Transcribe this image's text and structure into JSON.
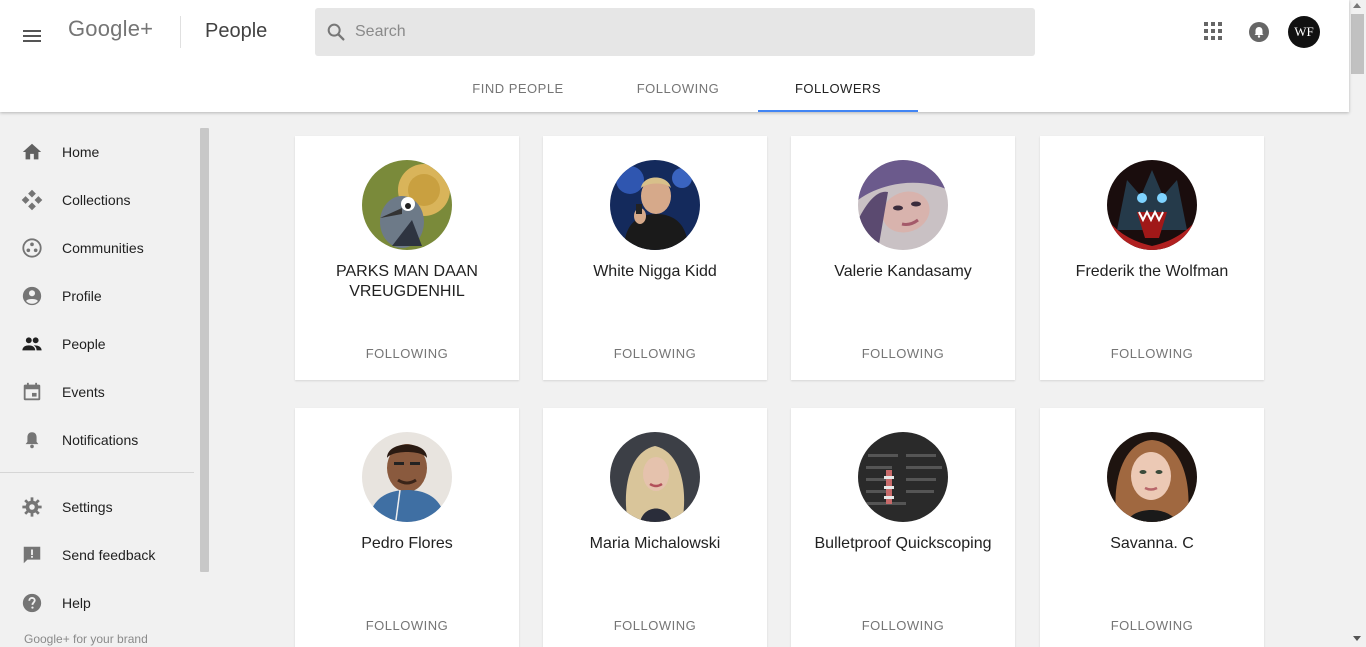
{
  "header": {
    "brand": "Google+",
    "title": "People",
    "search": {
      "placeholder": "Search",
      "value": ""
    },
    "account_initials": "WF"
  },
  "tabs": [
    {
      "label": "FIND PEOPLE",
      "active": false
    },
    {
      "label": "FOLLOWING",
      "active": false
    },
    {
      "label": "FOLLOWERS",
      "active": true
    }
  ],
  "sidebar": {
    "items": [
      {
        "label": "Home",
        "icon": "home-icon"
      },
      {
        "label": "Collections",
        "icon": "collections-icon"
      },
      {
        "label": "Communities",
        "icon": "communities-icon"
      },
      {
        "label": "Profile",
        "icon": "profile-icon"
      },
      {
        "label": "People",
        "icon": "people-icon"
      },
      {
        "label": "Events",
        "icon": "events-icon"
      },
      {
        "label": "Notifications",
        "icon": "bell-icon"
      }
    ],
    "secondary": [
      {
        "label": "Settings",
        "icon": "gear-icon"
      },
      {
        "label": "Send feedback",
        "icon": "feedback-icon"
      },
      {
        "label": "Help",
        "icon": "help-icon"
      }
    ],
    "footer_link": "Google+ for your brand"
  },
  "people": [
    {
      "name": "PARKS MAN DAAN VREUGDENHIL",
      "status": "FOLLOWING"
    },
    {
      "name": "White Nigga Kidd",
      "status": "FOLLOWING"
    },
    {
      "name": "Valerie Kandasamy",
      "status": "FOLLOWING"
    },
    {
      "name": "Frederik the Wolfman",
      "status": "FOLLOWING"
    },
    {
      "name": "Pedro Flores",
      "status": "FOLLOWING"
    },
    {
      "name": "Maria Michalowski",
      "status": "FOLLOWING"
    },
    {
      "name": "Bulletproof Quickscoping",
      "status": "FOLLOWING"
    },
    {
      "name": "Savanna. C",
      "status": "FOLLOWING"
    }
  ],
  "colors": {
    "accent": "#4285f4",
    "background": "#f1f1f1",
    "card": "#ffffff"
  }
}
